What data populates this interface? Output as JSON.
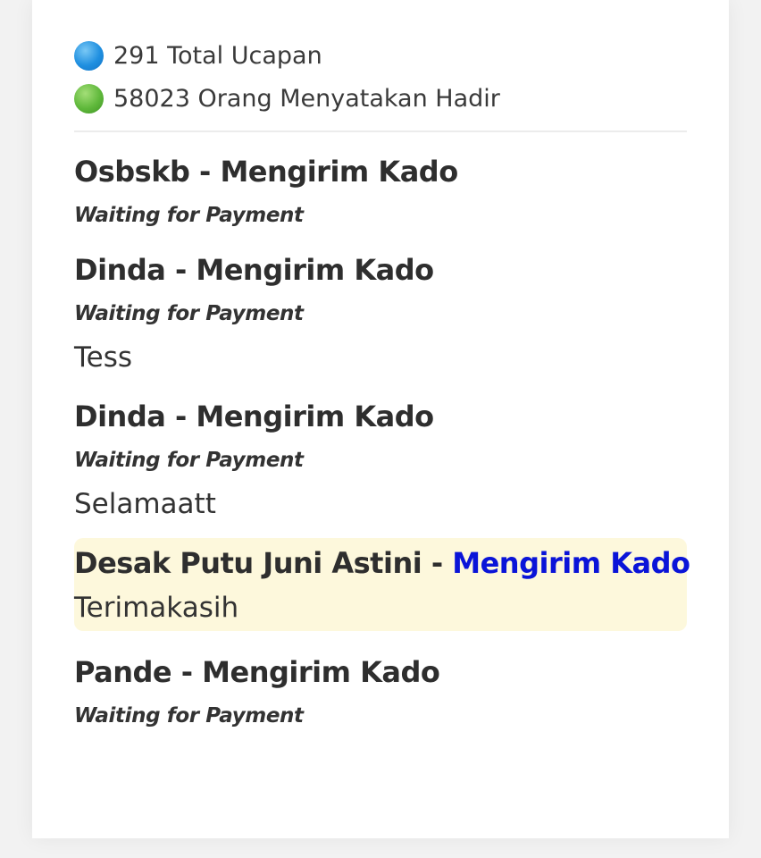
{
  "stats": {
    "total_ucapan": "291 Total Ucapan",
    "hadir": "58023 Orang Menyatakan Hadir",
    "icons": {
      "total": "blue-circle-icon",
      "hadir": "green-circle-icon"
    }
  },
  "colors": {
    "link": "#0a14d8",
    "highlight_bg": "#fdf8dc"
  },
  "entries": [
    {
      "name": "Osbskb",
      "separator": " - ",
      "action": "Mengirim Kado",
      "status": "Waiting for Payment",
      "message": ""
    },
    {
      "name": "Dinda",
      "separator": " - ",
      "action": "Mengirim Kado",
      "status": "Waiting for Payment",
      "message": "Tess"
    },
    {
      "name": "Dinda",
      "separator": " - ",
      "action": "Mengirim Kado",
      "status": "Waiting for Payment",
      "message": "Selamaatt"
    },
    {
      "name": "Desak Putu Juni Astini",
      "separator": " - ",
      "action": "Mengirim Kado",
      "status": "",
      "message": "Terimakasih",
      "highlighted": true
    },
    {
      "name": "Pande",
      "separator": " - ",
      "action": "Mengirim Kado",
      "status": "Waiting for Payment",
      "message": ""
    }
  ]
}
